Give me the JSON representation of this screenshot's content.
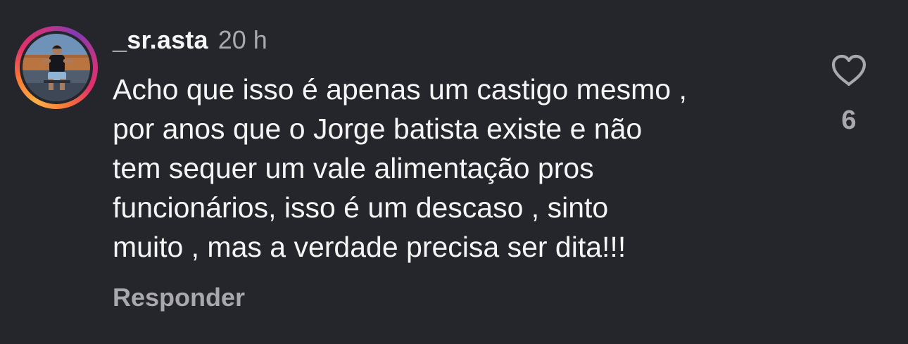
{
  "comment": {
    "username": "_sr.asta",
    "time": "20 h",
    "lines": [
      "Acho que isso é apenas um castigo mesmo ,",
      "por anos que o Jorge batista existe e não",
      "tem sequer um vale alimentação pros",
      "funcionários, isso é um descaso , sinto",
      "muito , mas a verdade precisa ser dita!!!"
    ],
    "reply_label": "Responder",
    "like_count": "6",
    "like_icon": "heart-outline-icon",
    "avatar_icon": "profile-photo",
    "colors": {
      "background": "#25262b",
      "primary_text": "#f5f5f5",
      "secondary_text": "#a8a8ad",
      "story_ring_start": "#fcaf45",
      "story_ring_mid": "#e1306c",
      "story_ring_end": "#833ab4"
    }
  }
}
